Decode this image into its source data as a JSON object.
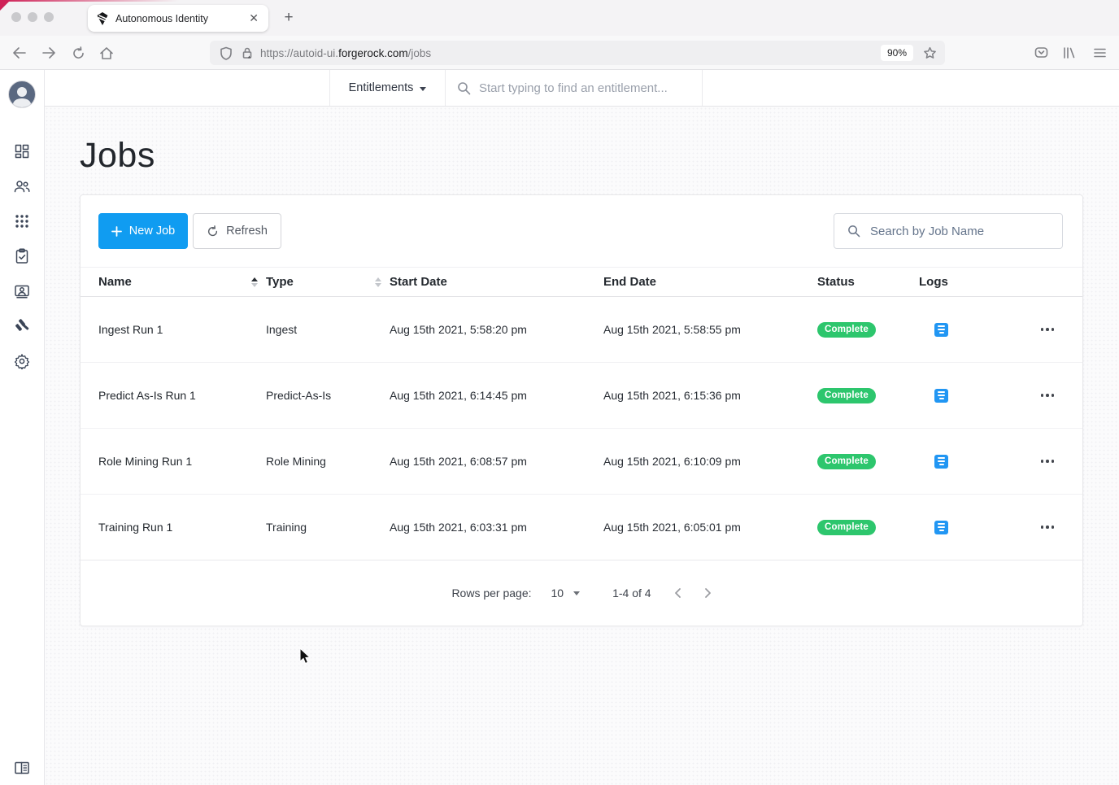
{
  "browser": {
    "tab_title": "Autonomous Identity",
    "url_scheme": "https://autoid-ui.",
    "url_domain": "forgerock.com",
    "url_path": "/jobs",
    "zoom_badge": "90%"
  },
  "app_topbar": {
    "context_dropdown_label": "Entitlements",
    "entitlement_search_placeholder": "Start typing to find an entitlement..."
  },
  "page": {
    "title": "Jobs",
    "new_job_button": "New Job",
    "refresh_button": "Refresh",
    "job_search_placeholder": "Search by Job Name"
  },
  "table": {
    "headers": {
      "name": "Name",
      "type": "Type",
      "start": "Start Date",
      "end": "End Date",
      "status": "Status",
      "logs": "Logs"
    },
    "rows": [
      {
        "name": "Ingest Run 1",
        "type": "Ingest",
        "start": "Aug 15th 2021, 5:58:20 pm",
        "end": "Aug 15th 2021, 5:58:55 pm",
        "status": "Complete"
      },
      {
        "name": "Predict As-Is Run 1",
        "type": "Predict-As-Is",
        "start": "Aug 15th 2021, 6:14:45 pm",
        "end": "Aug 15th 2021, 6:15:36 pm",
        "status": "Complete"
      },
      {
        "name": "Role Mining Run 1",
        "type": "Role Mining",
        "start": "Aug 15th 2021, 6:08:57 pm",
        "end": "Aug 15th 2021, 6:10:09 pm",
        "status": "Complete"
      },
      {
        "name": "Training Run 1",
        "type": "Training",
        "start": "Aug 15th 2021, 6:03:31 pm",
        "end": "Aug 15th 2021, 6:05:01 pm",
        "status": "Complete"
      }
    ]
  },
  "pagination": {
    "rows_per_page_label": "Rows per page:",
    "rows_per_page_value": "10",
    "range_label": "1-4 of 4"
  },
  "colors": {
    "primary_blue": "#109cf1",
    "success_green": "#2dc66d",
    "logs_icon_blue": "#2196f3"
  }
}
